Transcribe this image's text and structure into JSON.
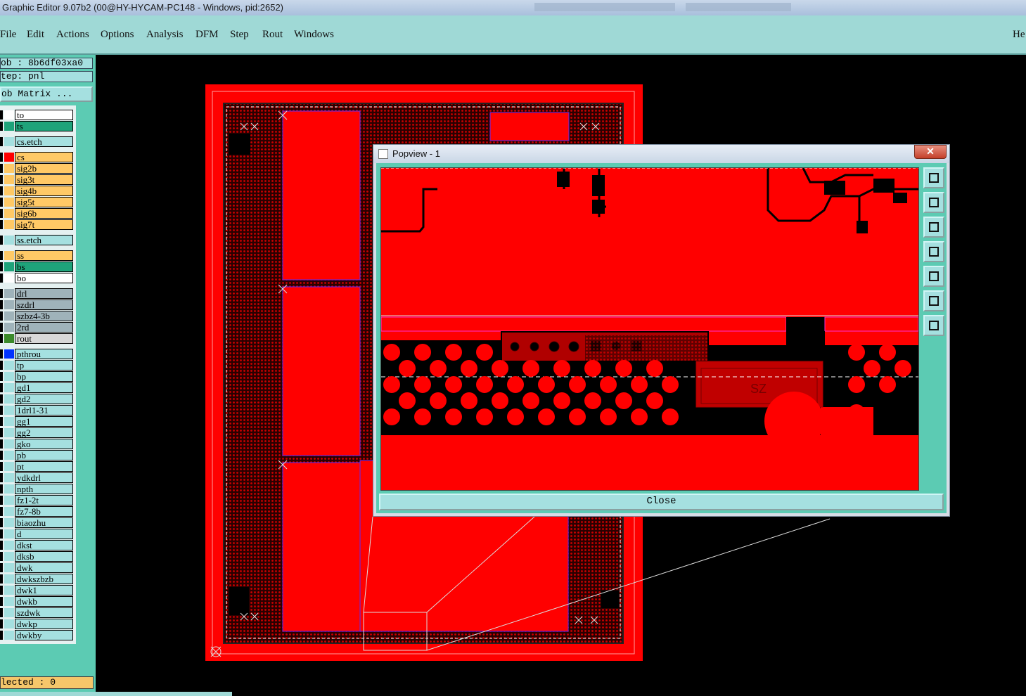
{
  "window": {
    "title": "Graphic Editor 9.07b2 (00@HY-HYCAM-PC148 - Windows, pid:2652)"
  },
  "menu": [
    "File",
    "Edit",
    "Actions",
    "Options",
    "Analysis",
    "DFM",
    "Step",
    "Rout",
    "Windows"
  ],
  "menu_right": "He",
  "panel": {
    "job": "ob : 8b6df03xa0",
    "step": "tep: pnl",
    "matrix_button": "ob Matrix ...",
    "selected": "lected : 0"
  },
  "colors": {
    "board": "#ff0000",
    "ui_bg": "#5ccbb3",
    "menu_bg": "#9fd9d6",
    "layer_orange": "#ffc966",
    "layer_green": "#1ea37a",
    "layer_grey": "#9fb3ba"
  },
  "layers": [
    {
      "name": "to",
      "color": "#ffffff",
      "fill": "#ffffff"
    },
    {
      "name": "ts",
      "color": "#1ea37a",
      "fill": "#1ea37a"
    },
    {
      "name": "cs.etch",
      "color": "#a5e0e0",
      "fill": "#a5e0e0",
      "gap": true
    },
    {
      "name": "cs",
      "color": "#ff0000",
      "fill": "#ffc966",
      "gap": true,
      "active": true
    },
    {
      "name": "sig2b",
      "color": "#ffc966",
      "fill": "#ffc966"
    },
    {
      "name": "sig3t",
      "color": "#ffc966",
      "fill": "#ffc966"
    },
    {
      "name": "sig4b",
      "color": "#ffc966",
      "fill": "#ffc966"
    },
    {
      "name": "sig5t",
      "color": "#ffc966",
      "fill": "#ffc966"
    },
    {
      "name": "sig6b",
      "color": "#ffc966",
      "fill": "#ffc966"
    },
    {
      "name": "sig7t",
      "color": "#ffc966",
      "fill": "#ffc966"
    },
    {
      "name": "ss.etch",
      "color": "#a5e0e0",
      "fill": "#a5e0e0",
      "gap": true
    },
    {
      "name": "ss",
      "color": "#ffc966",
      "fill": "#ffc966",
      "gap": true
    },
    {
      "name": "bs",
      "color": "#1ea37a",
      "fill": "#1ea37a"
    },
    {
      "name": "bo",
      "color": "#ffffff",
      "fill": "#ffffff"
    },
    {
      "name": "drl",
      "color": "#9fb3ba",
      "fill": "#9fb3ba",
      "gap": true
    },
    {
      "name": "szdrl",
      "color": "#9fb3ba",
      "fill": "#9fb3ba"
    },
    {
      "name": "szbz4-3b",
      "color": "#9fb3ba",
      "fill": "#9fb3ba"
    },
    {
      "name": "2rd",
      "color": "#9fb3ba",
      "fill": "#9fb3ba"
    },
    {
      "name": "rout",
      "color": "#3a8a2a",
      "fill": "#d8d8d8"
    },
    {
      "name": "pthrou",
      "color": "#0033ff",
      "fill": "#a5e0e0",
      "gap": true
    },
    {
      "name": "tp",
      "color": "#a5e0e0",
      "fill": "#a5e0e0"
    },
    {
      "name": "bp",
      "color": "#a5e0e0",
      "fill": "#a5e0e0"
    },
    {
      "name": "gd1",
      "color": "#a5e0e0",
      "fill": "#a5e0e0"
    },
    {
      "name": "gd2",
      "color": "#a5e0e0",
      "fill": "#a5e0e0"
    },
    {
      "name": "1drl1-31",
      "color": "#a5e0e0",
      "fill": "#a5e0e0"
    },
    {
      "name": "gg1",
      "color": "#a5e0e0",
      "fill": "#a5e0e0"
    },
    {
      "name": "gg2",
      "color": "#a5e0e0",
      "fill": "#a5e0e0"
    },
    {
      "name": "gko",
      "color": "#a5e0e0",
      "fill": "#a5e0e0"
    },
    {
      "name": "pb",
      "color": "#a5e0e0",
      "fill": "#a5e0e0"
    },
    {
      "name": "pt",
      "color": "#a5e0e0",
      "fill": "#a5e0e0"
    },
    {
      "name": "ydkdrl",
      "color": "#a5e0e0",
      "fill": "#a5e0e0"
    },
    {
      "name": "npth",
      "color": "#a5e0e0",
      "fill": "#a5e0e0"
    },
    {
      "name": "fz1-2t",
      "color": "#a5e0e0",
      "fill": "#a5e0e0"
    },
    {
      "name": "fz7-8b",
      "color": "#a5e0e0",
      "fill": "#a5e0e0"
    },
    {
      "name": "biaozhu",
      "color": "#a5e0e0",
      "fill": "#a5e0e0"
    },
    {
      "name": "d",
      "color": "#a5e0e0",
      "fill": "#a5e0e0"
    },
    {
      "name": "dkst",
      "color": "#a5e0e0",
      "fill": "#a5e0e0"
    },
    {
      "name": "dksb",
      "color": "#a5e0e0",
      "fill": "#a5e0e0"
    },
    {
      "name": "dwk",
      "color": "#a5e0e0",
      "fill": "#a5e0e0"
    },
    {
      "name": "dwkszbzb",
      "color": "#a5e0e0",
      "fill": "#a5e0e0"
    },
    {
      "name": "dwk1",
      "color": "#a5e0e0",
      "fill": "#a5e0e0"
    },
    {
      "name": "dwkb",
      "color": "#a5e0e0",
      "fill": "#a5e0e0"
    },
    {
      "name": "szdwk",
      "color": "#a5e0e0",
      "fill": "#a5e0e0"
    },
    {
      "name": "dwkp",
      "color": "#a5e0e0",
      "fill": "#a5e0e0"
    },
    {
      "name": "dwkby",
      "color": "#a5e0e0",
      "fill": "#a5e0e0"
    }
  ],
  "popview": {
    "title": "Popview - 1",
    "close_x": "✕",
    "close_label": "Close",
    "silk_text": "SZ",
    "tools": [
      "zoom-fit-icon",
      "pan-up-icon",
      "pan-down-icon",
      "pan-left-icon",
      "pan-right-icon",
      "zoom-out-icon",
      "zoom-in-icon"
    ]
  }
}
